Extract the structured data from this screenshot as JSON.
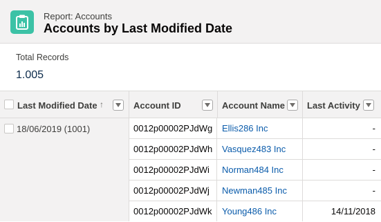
{
  "header": {
    "eyebrow": "Report: Accounts",
    "title": "Accounts by Last Modified Date",
    "icon": "report-icon",
    "accent_color": "#3cc2a6"
  },
  "summary": {
    "label": "Total Records",
    "value": "1.005"
  },
  "table": {
    "columns": [
      {
        "label": "Last Modified Date",
        "sort": "ascending"
      },
      {
        "label": "Account ID"
      },
      {
        "label": "Account Name"
      },
      {
        "label": "Last Activity"
      }
    ],
    "group": {
      "label": "18/06/2019 (1001)"
    },
    "rows": [
      {
        "account_id": "0012p00002PJdWg",
        "account_name": "Ellis286 Inc",
        "last_activity": "-"
      },
      {
        "account_id": "0012p00002PJdWh",
        "account_name": "Vasquez483 Inc",
        "last_activity": "-"
      },
      {
        "account_id": "0012p00002PJdWi",
        "account_name": "Norman484 Inc",
        "last_activity": "-"
      },
      {
        "account_id": "0012p00002PJdWj",
        "account_name": "Newman485 Inc",
        "last_activity": "-"
      },
      {
        "account_id": "0012p00002PJdWk",
        "account_name": "Young486 Inc",
        "last_activity": "14/11/2018"
      }
    ],
    "link_color": "#0b5cab"
  }
}
